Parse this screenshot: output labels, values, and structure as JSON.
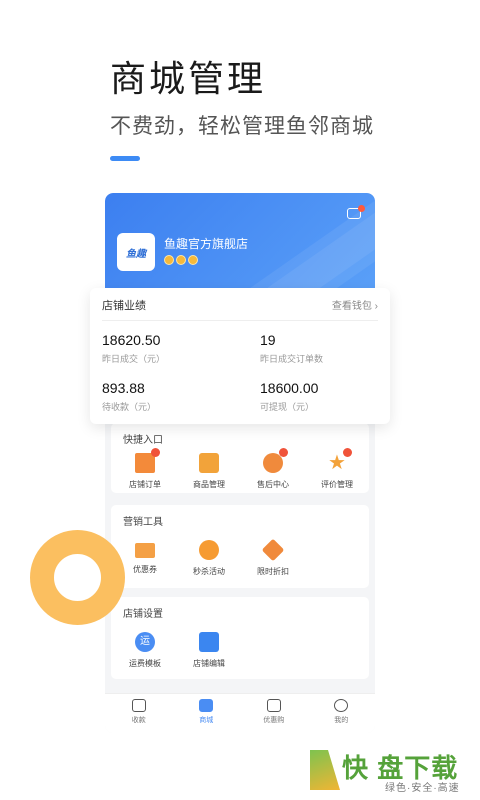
{
  "hero": {
    "title": "商城管理",
    "subtitle": "不费劲，轻松管理鱼邻商城",
    "accent": "#3d8bf5"
  },
  "store": {
    "name": "鱼趣官方旗舰店",
    "logo_text": "鱼趣",
    "banner_color": "#3c7ff0",
    "icons": [
      "message-icon"
    ]
  },
  "performance": {
    "title": "店铺业绩",
    "wallet_link": "查看钱包",
    "stats": [
      {
        "value": "18620.50",
        "label": "昨日成交（元）"
      },
      {
        "value": "19",
        "label": "昨日成交订单数"
      },
      {
        "value": "893.88",
        "label": "待收款（元）"
      },
      {
        "value": "18600.00",
        "label": "可提现（元）"
      }
    ]
  },
  "quick": {
    "title": "快捷入口",
    "items": [
      {
        "label": "店铺订单",
        "icon": "order-icon",
        "dot": true
      },
      {
        "label": "商品管理",
        "icon": "goods-icon",
        "dot": false
      },
      {
        "label": "售后中心",
        "icon": "after-sale-icon",
        "dot": true
      },
      {
        "label": "评价管理",
        "icon": "review-star-icon",
        "dot": true
      }
    ]
  },
  "marketing": {
    "title": "营销工具",
    "items": [
      {
        "label": "优惠券",
        "icon": "coupon-icon"
      },
      {
        "label": "秒杀活动",
        "icon": "flash-sale-icon"
      },
      {
        "label": "限时折扣",
        "icon": "discount-icon"
      }
    ]
  },
  "settings": {
    "title": "店铺设置",
    "items": [
      {
        "label": "运费模板",
        "icon": "shipping-icon",
        "glyph": "运"
      },
      {
        "label": "店铺编辑",
        "icon": "store-edit-icon"
      }
    ]
  },
  "tabbar": [
    {
      "label": "收款",
      "active": false
    },
    {
      "label": "商城",
      "active": true
    },
    {
      "label": "优惠购",
      "active": false
    },
    {
      "label": "我的",
      "active": false
    }
  ],
  "watermark": {
    "brand": "快 盘下载",
    "tagline": "绿色·安全·高速"
  },
  "colors": {
    "orange_accent": "#f38a3a",
    "ring": "#fbbf60",
    "active_tab": "#4a8df3"
  }
}
